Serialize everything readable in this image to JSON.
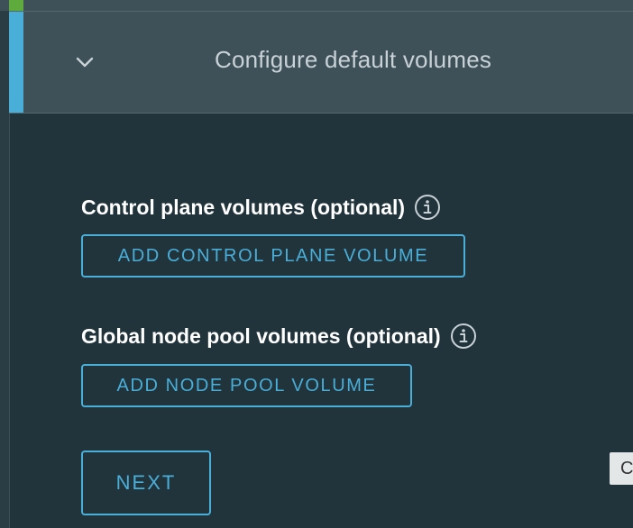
{
  "section": {
    "title": "Configure default volumes"
  },
  "control_plane": {
    "label": "Control plane volumes (optional)",
    "button_label": "ADD CONTROL PLANE VOLUME"
  },
  "node_pool": {
    "label": "Global node pool volumes (optional)",
    "button_label": "ADD NODE POOL VOLUME"
  },
  "next_button": "NEXT",
  "edge_tab": {
    "text": "C"
  },
  "colors": {
    "accent": "#49afd9",
    "background": "#21333b",
    "header": "#3f5158",
    "status_green": "#5faa3c"
  },
  "icons": [
    "chevron-down-icon",
    "info-icon"
  ]
}
